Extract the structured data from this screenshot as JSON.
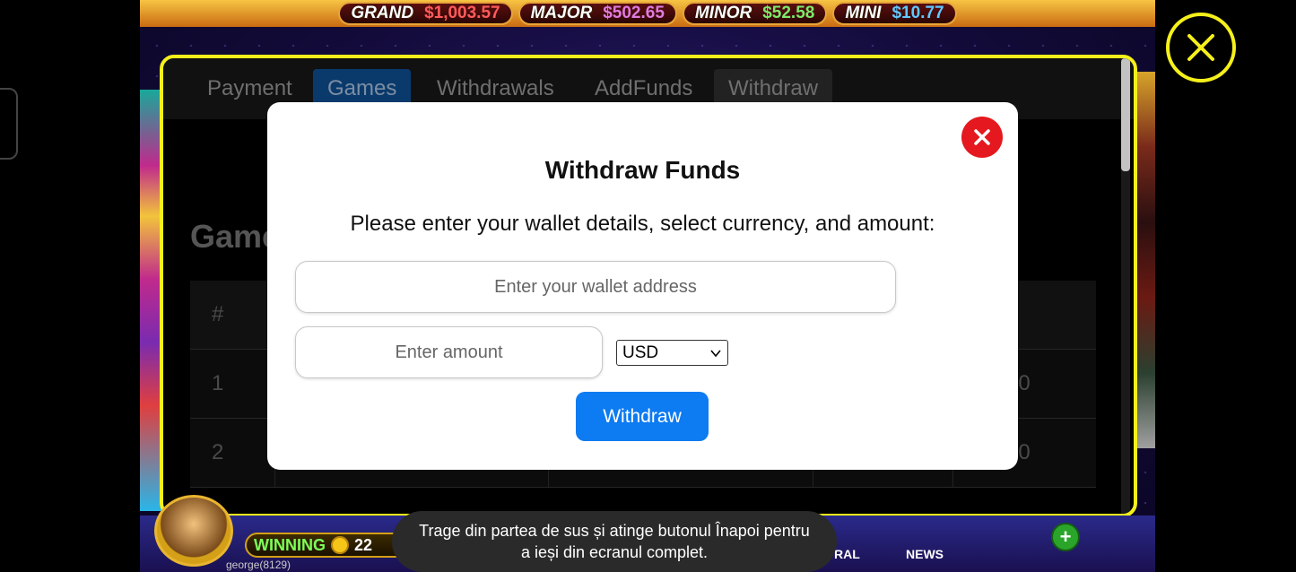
{
  "jackpots": [
    {
      "name": "GRAND",
      "value": "$1,003.57"
    },
    {
      "name": "MAJOR",
      "value": "$502.65"
    },
    {
      "name": "MINOR",
      "value": "$52.58"
    },
    {
      "name": "MINI",
      "value": "$10.77"
    }
  ],
  "tabs": [
    {
      "label": "Payment"
    },
    {
      "label": "Games"
    },
    {
      "label": "Withdrawals"
    },
    {
      "label": "AddFunds"
    },
    {
      "label": "Withdraw"
    }
  ],
  "page": {
    "heading": "Game",
    "table": {
      "header_first": "#",
      "rows": [
        {
          "num": "1",
          "tail": "00"
        },
        {
          "num": "2",
          "tail": "00"
        }
      ]
    }
  },
  "modal": {
    "title": "Withdraw Funds",
    "description": "Please enter your wallet details, select currency, and amount:",
    "wallet_placeholder": "Enter your wallet address",
    "amount_placeholder": "Enter amount",
    "currency_selected": "USD",
    "submit_label": "Withdraw"
  },
  "game_bar": {
    "winning_label": "WINNING",
    "winning_value": "22",
    "username": "george(8129)",
    "news_label": "NEWS",
    "partial_label": "RAL"
  },
  "toast": {
    "text": "Trage din partea de sus și atinge butonul Înapoi pentru a ieși din ecranul complet."
  },
  "colors": {
    "accent_yellow": "#f5f01a",
    "primary_blue": "#0d7bf2",
    "close_red": "#e4181e"
  }
}
